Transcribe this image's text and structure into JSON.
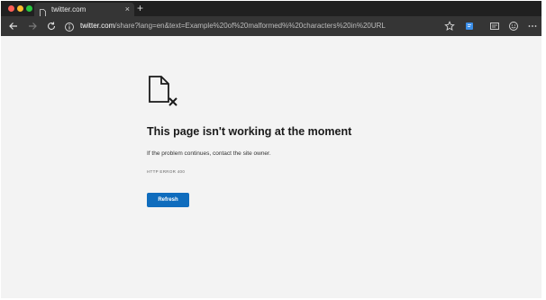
{
  "tab": {
    "title": "twitter.com",
    "close_glyph": "×",
    "favicon": "page-icon"
  },
  "new_tab": {
    "glyph": "+"
  },
  "address_bar": {
    "host": "twitter.com",
    "path": "/share?lang=en&text=Example%20of%20malformed%%20characters%20in%20URL"
  },
  "window_controls": [
    "close",
    "minimize",
    "maximize"
  ],
  "toolbar_icons": [
    "back-icon",
    "forward-icon",
    "reload-icon",
    "info-icon",
    "star-icon",
    "collections-icon",
    "reading-icon",
    "smiley-icon",
    "more-icon"
  ],
  "error": {
    "icon": "broken-page-icon",
    "title": "This page isn't working at the moment",
    "message": "If the problem continues, contact the site owner.",
    "code": "HTTP ERROR 400",
    "button_label": "Refresh"
  },
  "colors": {
    "accent": "#0f6cbd",
    "titlebar": "#202020",
    "toolbar": "#353535",
    "page_bg": "#f3f3f3"
  }
}
